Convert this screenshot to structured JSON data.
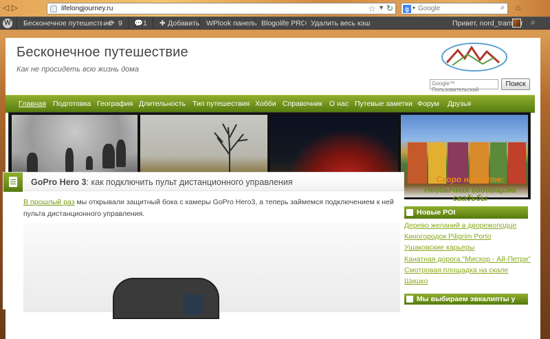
{
  "browser": {
    "url": "lifelongjourney.ru",
    "search_placeholder": "Google",
    "search_engine_icon": "g"
  },
  "adminbar": {
    "items": [
      "Бесконечное путешествие",
      "9",
      "1",
      "Добавить",
      "WPlook панель",
      "Blogolife PRO",
      "Удалить весь кэш"
    ],
    "greeting": "Привет, nord_tramper"
  },
  "site": {
    "title": "Бесконечное путешествие",
    "tagline": "Как не просидеть всю жизнь дома",
    "search_label": "Google™ Пользовательский",
    "search_button": "Поиск"
  },
  "menu": [
    "Главная",
    "Подготовка",
    "География",
    "Длительность",
    "Тип путешествия",
    "Хобби",
    "Справочник",
    "О нас",
    "Путевые заметки",
    "Форум",
    "Друзья"
  ],
  "post": {
    "title_bold": "GoPro Hero 3",
    "title_rest": ": как подключить пульт дистанционного управления",
    "link_text": "В прошлый раз",
    "body_text": " мы открывали защитный бока с камеры GoPro Hero3, а теперь займемся подключением к ней пульта дистанционного управления."
  },
  "sidebar": {
    "soon": "Скоро на сайте:",
    "anniversary": "Необычная годовщина свадьбы",
    "widget1_title": "Новые POI",
    "poi": [
      "Дерево желаний в дворежоподце",
      "Киногородок Piligrim Porto",
      "Ушаковские карьеры",
      "Канатная дорога \"Мисхор - Ай-Петри\"",
      "Смотровая площадка на скале",
      "Шишко"
    ],
    "widget2_title": "Мы выбираем эвкалипты у"
  },
  "colors": {
    "accent": "#7a9a1a",
    "menu": "#6b8e1e",
    "orange": "#e88a1a"
  }
}
